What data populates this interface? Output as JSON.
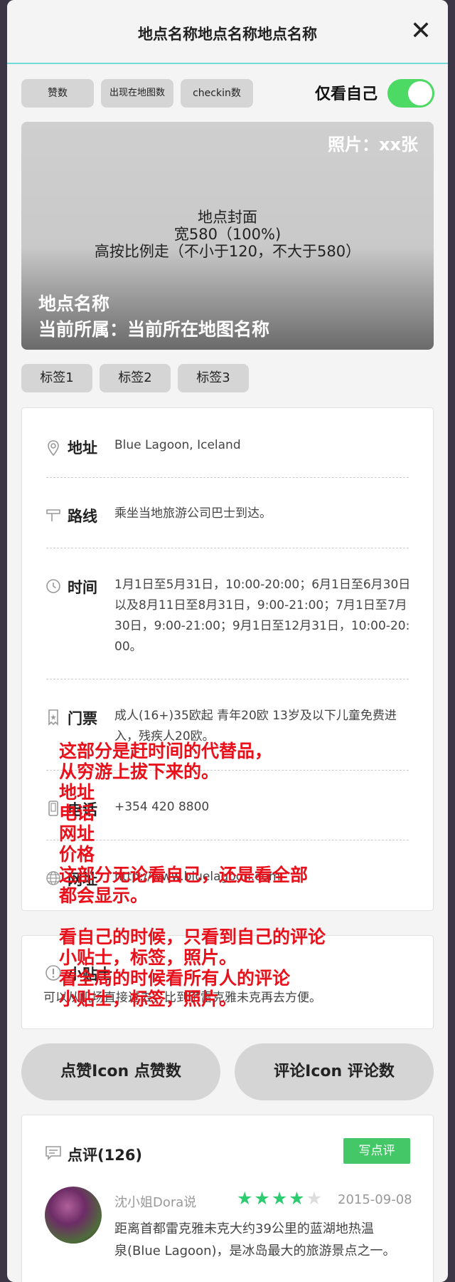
{
  "header": {
    "title": "地点名称地点名称地点名称",
    "close_label": "✕"
  },
  "stats": {
    "likes_label": "赞数",
    "maps_label": "出现在地图数",
    "checkin_label": "checkin数"
  },
  "only_me": {
    "label": "仅看自己",
    "on": true
  },
  "cover": {
    "photo_count": "照片：xx张",
    "placeholder_line1": "地点封面",
    "placeholder_line2": "宽580（100%)",
    "placeholder_line3": "高按比例走（不小于120，不大于580）",
    "place_name": "地点名称",
    "current_map": "当前所属：当前所在地图名称"
  },
  "tags": [
    "标签1",
    "标签2",
    "标签3"
  ],
  "info": {
    "address": {
      "label": "地址",
      "value": "Blue Lagoon, Iceland"
    },
    "route": {
      "label": "路线",
      "value": "乘坐当地旅游公司巴士到达。"
    },
    "time": {
      "label": "时间",
      "value": "1月1日至5月31日，10:00-20:00；6月1日至6月30日以及8月11日至8月31日，9:00-21:00；7月1日至7月30日，9:00-21:00；9月1日至12月31日，10:00-20:00。"
    },
    "ticket": {
      "label": "门票",
      "value": "成人(16+)35欧起 青年20欧 13岁及以下儿童免费进入，残疾人20欧。"
    },
    "phone": {
      "label": "电话",
      "value": "+354 420 8800"
    },
    "website": {
      "label": "网址",
      "value": "http://www.bluelagoon.com"
    }
  },
  "tips": {
    "label": "小贴士",
    "value": "可以从机场直接过去，比到了雷克雅未克再去方便。"
  },
  "actions": {
    "like_label": "点赞Icon 点赞数",
    "comment_label": "评论Icon 评论数"
  },
  "reviews": {
    "title": "点评(126)",
    "write_label": "写点评",
    "items": [
      {
        "user": "沈小姐Dora说",
        "rating": 4,
        "date": "2015-09-08",
        "text_line1": "距离首都雷克雅未克大约39公里的蓝湖地热温",
        "text_line2": "泉(Blue Lagoon)，是冰岛最大的旅游景点之一。"
      }
    ]
  },
  "annotations": [
    "这部分是赶时间的代替品，",
    "从穷游上拔下来的。",
    "地址",
    "电话",
    "网址",
    "价格",
    "这部分无论看自己，还是看全部",
    "都会显示。",
    "看自己的时候，只看到自己的评论",
    "小贴士，标签，照片。",
    "看全局的时候看所有人的评论",
    "小贴士，标签，照片。"
  ],
  "colors": {
    "accent_teal": "#73dcd8",
    "toggle_green": "#4cd964",
    "write_button": "#44c767",
    "star": "#2ecc71",
    "annotation_red": "#e8101a"
  }
}
